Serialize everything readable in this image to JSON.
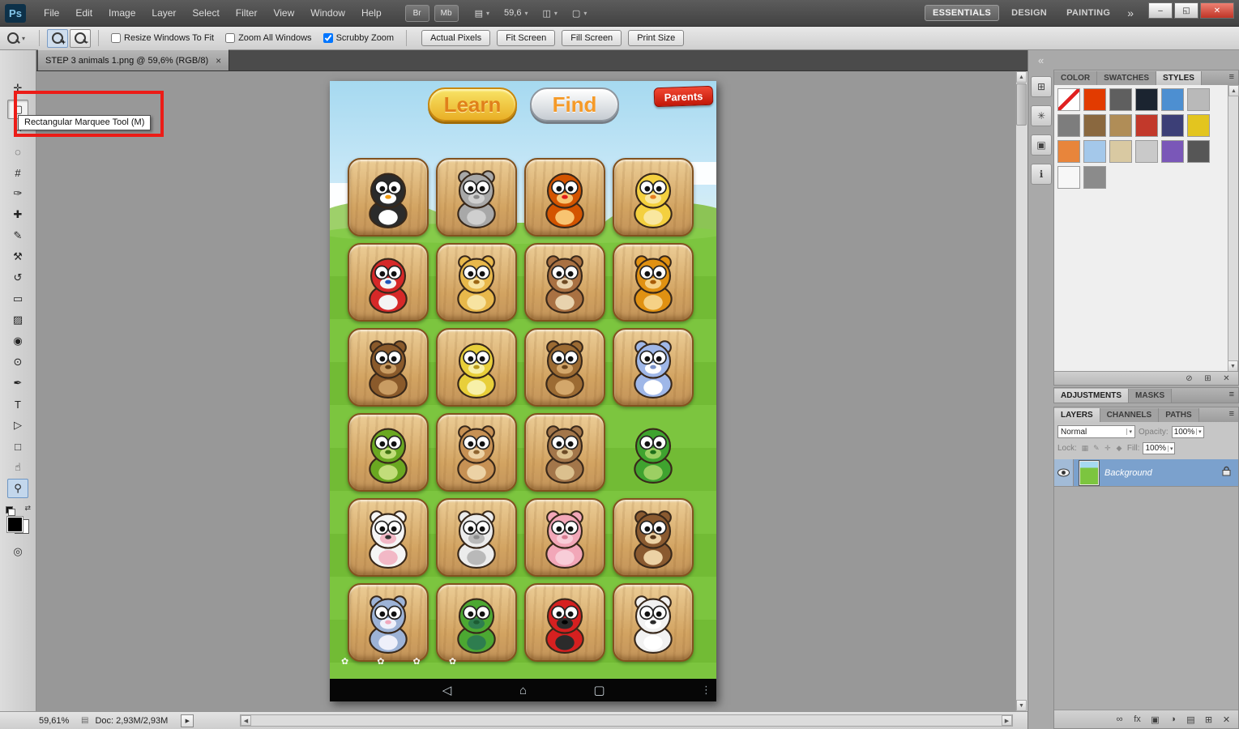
{
  "window": {
    "controls": {
      "minimize": "–",
      "restore": "◱",
      "close": "✕"
    }
  },
  "ui": {
    "dropdown": "▾",
    "up": "▲",
    "down": "▼",
    "left": "◀",
    "right": "▶"
  },
  "menubar": {
    "logo": "Ps",
    "menus": [
      "File",
      "Edit",
      "Image",
      "Layer",
      "Select",
      "Filter",
      "View",
      "Window",
      "Help"
    ],
    "quick_buttons": [
      {
        "name": "bridge-button",
        "label": "Br"
      },
      {
        "name": "mini-bridge-button",
        "label": "Mb"
      }
    ],
    "icon_buttons": [
      {
        "name": "view-extras-button",
        "glyph": "▤"
      },
      {
        "name": "zoom-level-dropdown",
        "label": "59,6"
      },
      {
        "name": "arrange-documents-button",
        "glyph": "◫"
      },
      {
        "name": "screen-mode-button",
        "glyph": "▢"
      }
    ],
    "workspaces": [
      "ESSENTIALS",
      "DESIGN",
      "PAINTING"
    ],
    "active_workspace": "ESSENTIALS",
    "overflow_glyph": "»"
  },
  "options_bar": {
    "zoom_in_sign": "+",
    "zoom_out_sign": "−",
    "checkboxes": [
      {
        "label": "Resize Windows To Fit",
        "checked": false
      },
      {
        "label": "Zoom All Windows",
        "checked": false
      },
      {
        "label": "Scrubby Zoom",
        "checked": true
      }
    ],
    "buttons": [
      "Actual Pixels",
      "Fit Screen",
      "Fill Screen",
      "Print Size"
    ]
  },
  "tab_bar": {
    "document_title": "STEP 3 animals 1.png @ 59,6% (RGB/8)",
    "close_glyph": "×",
    "collapse_glyph": "«"
  },
  "tools": [
    {
      "name": "move",
      "glyph": "✛"
    },
    {
      "name": "rectangular-marquee",
      "glyph": "▢",
      "state": "pressed"
    },
    {
      "name": "lasso",
      "glyph": "∽"
    },
    {
      "name": "quick-selection",
      "glyph": "◌"
    },
    {
      "name": "crop",
      "glyph": "#"
    },
    {
      "name": "eyedropper",
      "glyph": "✑"
    },
    {
      "name": "spot-healing-brush",
      "glyph": "✚"
    },
    {
      "name": "brush",
      "glyph": "✎"
    },
    {
      "name": "clone-stamp",
      "glyph": "⚒"
    },
    {
      "name": "history-brush",
      "glyph": "↺"
    },
    {
      "name": "eraser",
      "glyph": "▭"
    },
    {
      "name": "gradient",
      "glyph": "▨"
    },
    {
      "name": "blur",
      "glyph": "◉"
    },
    {
      "name": "dodge",
      "glyph": "⊙"
    },
    {
      "name": "pen",
      "glyph": "✒"
    },
    {
      "name": "type",
      "glyph": "T"
    },
    {
      "name": "path-selection",
      "glyph": "▷"
    },
    {
      "name": "rectangle",
      "glyph": "□"
    },
    {
      "name": "hand",
      "glyph": "☝"
    },
    {
      "name": "zoom",
      "glyph": "⚲",
      "state": "selected"
    }
  ],
  "toolbar_extra": {
    "swap_glyph": "⇄",
    "quick_mask_glyph": "◎"
  },
  "annotation": {
    "tooltip_text": "Rectangular Marquee Tool (M)"
  },
  "app": {
    "learn_label": "Learn",
    "find_label": "Find",
    "parents_label": "Parents",
    "flowers": "✿ ✿ ✿ ✿",
    "overflow_glyph": "⋮",
    "nav_icons": [
      {
        "name": "back-icon",
        "glyph": "◁"
      },
      {
        "name": "home-icon",
        "glyph": "⌂"
      },
      {
        "name": "recents-icon",
        "glyph": "▢"
      }
    ],
    "animals": [
      {
        "name": "penguin",
        "body": "#2b2b2b",
        "belly": "#ffffff",
        "accent": "#f39c12",
        "no_ears": true
      },
      {
        "name": "rhinoceros",
        "body": "#a8a8a8",
        "belly": "#cfcfcf",
        "accent": "#8a8a8a"
      },
      {
        "name": "rooster",
        "body": "#d35400",
        "belly": "#f8c471",
        "accent": "#e01b1b",
        "no_ears": true
      },
      {
        "name": "duck",
        "body": "#f4d03f",
        "belly": "#f9e79f",
        "accent": "#e67e22",
        "no_ears": true
      },
      {
        "name": "parrot",
        "body": "#d62828",
        "belly": "#f4f4f4",
        "accent": "#2155b8",
        "no_ears": true
      },
      {
        "name": "giraffe",
        "body": "#e8b84b",
        "belly": "#f7e3a1",
        "accent": "#9c6615"
      },
      {
        "name": "dog",
        "body": "#a97142",
        "belly": "#e8d3ae",
        "accent": "#6e4a23"
      },
      {
        "name": "lion",
        "body": "#e09112",
        "belly": "#f5d186",
        "accent": "#a85c08"
      },
      {
        "name": "moose",
        "body": "#8a5a2b",
        "belly": "#c99c63",
        "accent": "#5e3c17"
      },
      {
        "name": "fish",
        "body": "#e8cf3a",
        "belly": "#f7f0a8",
        "accent": "#b89a1e",
        "no_ears": true
      },
      {
        "name": "bear",
        "body": "#9c6b33",
        "belly": "#d3a76b",
        "accent": "#6a441c"
      },
      {
        "name": "rabbit",
        "body": "#9fb7e8",
        "belly": "#ffffff",
        "accent": "#7b93c9"
      },
      {
        "name": "snake",
        "body": "#6aa821",
        "belly": "#c2dd7a",
        "accent": "#3f7212",
        "no_ears": true
      },
      {
        "name": "kangaroo",
        "body": "#c79154",
        "belly": "#ecd2a5",
        "accent": "#8f6430"
      },
      {
        "name": "owl",
        "body": "#a3764a",
        "belly": "#dbc08e",
        "accent": "#6b4a26"
      },
      {
        "name": "crocodile",
        "body": "#3fa32f",
        "belly": "#9ccf63",
        "accent": "#1f6f1a",
        "no_ears": true,
        "no_tile": true
      },
      {
        "name": "cow",
        "body": "#f5f5f5",
        "belly": "#f2b8c6",
        "accent": "#333333"
      },
      {
        "name": "sheep",
        "body": "#ececec",
        "belly": "#b9b9b9",
        "accent": "#8d8d8d"
      },
      {
        "name": "pig",
        "body": "#f2a7b8",
        "belly": "#f8cdd8",
        "accent": "#d87b90"
      },
      {
        "name": "monkey",
        "body": "#8a5a30",
        "belly": "#ecd2a5",
        "accent": "#57371b"
      },
      {
        "name": "mouse",
        "body": "#9db3d6",
        "belly": "#eef0fa",
        "accent": "#f0a8bc"
      },
      {
        "name": "turtle",
        "body": "#4ca832",
        "belly": "#2e7d4f",
        "accent": "#1c5c33",
        "no_ears": true
      },
      {
        "name": "ladybug",
        "body": "#d62020",
        "belly": "#2b2b2b",
        "accent": "#000000",
        "no_ears": true
      },
      {
        "name": "zebra",
        "body": "#f2f2f2",
        "belly": "#ffffff",
        "accent": "#2b2b2b"
      }
    ]
  },
  "panels": {
    "dock_icons": [
      {
        "name": "dock-panel-icon-1",
        "glyph": "⊞"
      },
      {
        "name": "dock-panel-icon-2",
        "glyph": "✳"
      },
      {
        "name": "dock-panel-icon-3",
        "glyph": "▣"
      },
      {
        "name": "dock-panel-icon-4",
        "glyph": "ℹ"
      }
    ],
    "styles": {
      "tabs": [
        "COLOR",
        "SWATCHES",
        "STYLES"
      ],
      "active_tab": "STYLES",
      "menu_glyph": "≡",
      "swatches": [
        "none",
        "#e23b00",
        "#5f5f5f",
        "#1b2430",
        "#4d8fd1",
        "#b9b9b9",
        "#7d7d7d",
        "#8a683f",
        "#b08d57",
        "#c2392b",
        "#3c3f77",
        "#e3c51f",
        "#e8853b",
        "#a4c8ea",
        "#d9c9a2",
        "#c9c9c9",
        "#7a57b8",
        "#565656",
        "#f7f7f7",
        "#8b8b8b"
      ],
      "footer_icons": [
        {
          "name": "clear-style-button",
          "glyph": "⊘"
        },
        {
          "name": "new-style-button",
          "glyph": "⊞"
        },
        {
          "name": "delete-style-button",
          "glyph": "✕"
        }
      ]
    },
    "adjustments": {
      "tabs": [
        "ADJUSTMENTS",
        "MASKS"
      ],
      "active_tab": "ADJUSTMENTS",
      "menu_glyph": "≡"
    },
    "layers": {
      "tabs": [
        "LAYERS",
        "CHANNELS",
        "PATHS"
      ],
      "active_tab": "LAYERS",
      "menu_glyph": "≡",
      "blend_mode": "Normal",
      "opacity_label": "Opacity:",
      "opacity_value": "100%",
      "lock_label": "Lock:",
      "lock_icons": [
        {
          "name": "lock-transparency-icon",
          "glyph": "▦"
        },
        {
          "name": "lock-pixels-icon",
          "glyph": "✎"
        },
        {
          "name": "lock-position-icon",
          "glyph": "✛"
        },
        {
          "name": "lock-all-icon",
          "glyph": "◆"
        }
      ],
      "fill_label": "Fill:",
      "fill_value": "100%",
      "rows": [
        {
          "name": "Background",
          "selected": true,
          "visible": true,
          "locked": true
        }
      ],
      "footer_icons": [
        {
          "name": "link-layers-button",
          "glyph": "∞"
        },
        {
          "name": "layer-style-button",
          "glyph": "fx"
        },
        {
          "name": "layer-mask-button",
          "glyph": "▣"
        },
        {
          "name": "adjustment-layer-button",
          "glyph": "◑"
        },
        {
          "name": "layer-group-button",
          "glyph": "▤"
        },
        {
          "name": "new-layer-button",
          "glyph": "⊞"
        },
        {
          "name": "delete-layer-button",
          "glyph": "✕"
        }
      ]
    }
  },
  "status_bar": {
    "zoom": "59,61%",
    "page_icon": "▤",
    "doc_label": "Doc: 2,93M/2,93M",
    "flyout_glyph": "▶"
  }
}
